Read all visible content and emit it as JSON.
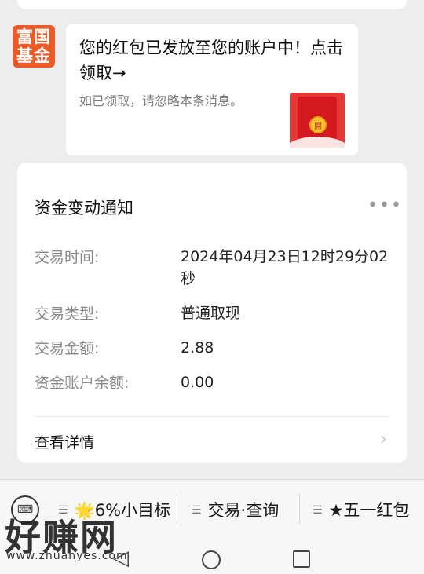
{
  "chat": {
    "avatar_line1": "富国",
    "avatar_line2": "基金",
    "message_title": "您的红包已发放至您的账户中！点击领取→",
    "message_sub": "如已领取，请忽略本条消息。",
    "envelope_mark": "開"
  },
  "card": {
    "title": "资金变动通知",
    "rows": [
      {
        "label": "交易时间:",
        "value": "2024年04月23日12时29分02秒"
      },
      {
        "label": "交易类型:",
        "value": "普通取现"
      },
      {
        "label": "交易金额:",
        "value": "2.88"
      },
      {
        "label": "资金账户余额:",
        "value": "0.00"
      }
    ],
    "detail_link": "查看详情"
  },
  "bottom_menu": {
    "items": [
      "🌟6%小目标",
      "交易·查询",
      "★五一红包"
    ]
  },
  "watermark": {
    "text": "好赚网",
    "url": "www.zhuanyes.com"
  },
  "colors": {
    "brand": "#ea5b28",
    "envelope": "#e53a35"
  }
}
